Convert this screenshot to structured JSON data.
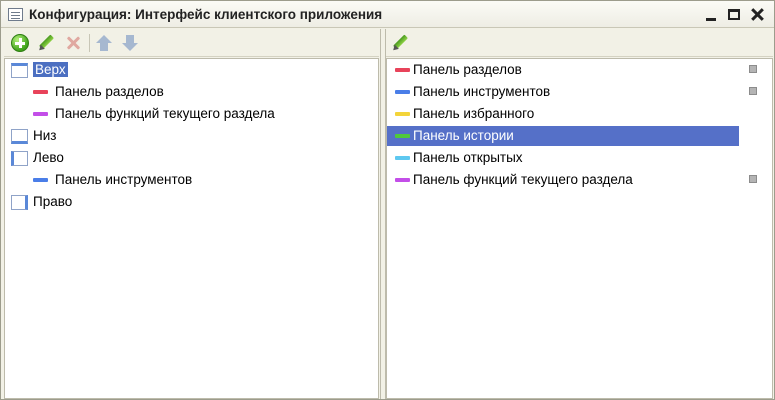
{
  "window": {
    "title": "Конфигурация: Интерфейс клиентского приложения"
  },
  "left_toolbar": {
    "buttons": [
      "add-icon",
      "pencil-icon",
      "delete-icon",
      "arrow-up-icon",
      "arrow-down-icon"
    ]
  },
  "right_toolbar": {
    "buttons": [
      "pencil-icon"
    ]
  },
  "left_tree": [
    {
      "label": "Верх",
      "kind": "position",
      "position": "top",
      "selected": true
    },
    {
      "label": "Панель разделов",
      "kind": "panel",
      "color": "#e8435a"
    },
    {
      "label": "Панель функций текущего раздела",
      "kind": "panel",
      "color": "#c34ee8"
    },
    {
      "label": "Низ",
      "kind": "position",
      "position": "bottom"
    },
    {
      "label": "Лево",
      "kind": "position",
      "position": "left"
    },
    {
      "label": "Панель инструментов",
      "kind": "panel",
      "color": "#4a7ee8"
    },
    {
      "label": "Право",
      "kind": "position",
      "position": "right"
    }
  ],
  "right_list": [
    {
      "label": "Панель разделов",
      "color": "#e8435a",
      "marked": true
    },
    {
      "label": "Панель инструментов",
      "color": "#4a7ee8",
      "marked": true
    },
    {
      "label": "Панель избранного",
      "color": "#f3d43a",
      "marked": false
    },
    {
      "label": "Панель истории",
      "color": "#4fc93c",
      "marked": false,
      "selected": true
    },
    {
      "label": "Панель открытых",
      "color": "#5ec8f0",
      "marked": false
    },
    {
      "label": "Панель функций текущего раздела",
      "color": "#c34ee8",
      "marked": true
    }
  ]
}
